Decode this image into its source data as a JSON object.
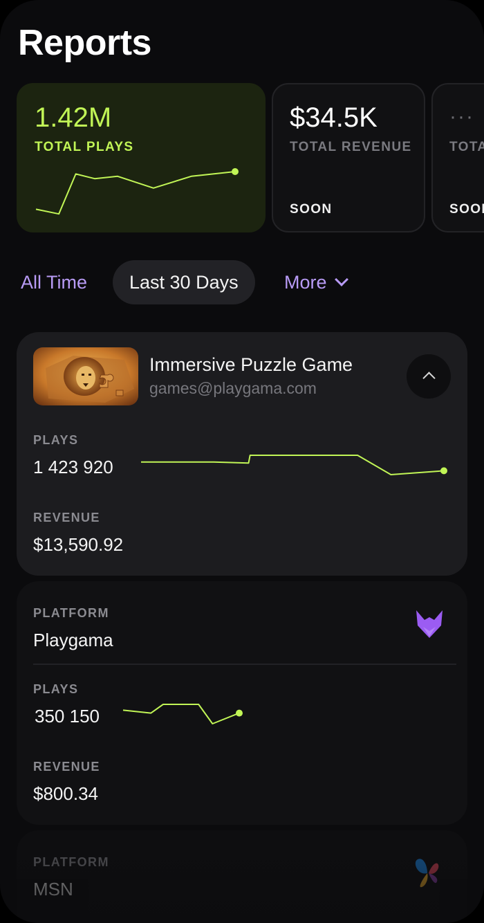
{
  "page": {
    "title": "Reports"
  },
  "stats": [
    {
      "value": "1.42M",
      "label": "TOTAL PLAYS",
      "trend": [
        0.2,
        0.1,
        0.95,
        0.85,
        0.9,
        0.65,
        0.9,
        1.0
      ]
    },
    {
      "value": "$34.5K",
      "label": "TOTAL REVENUE",
      "soon": "SOON"
    },
    {
      "value": "···",
      "label": "TOTA",
      "soon": "SOON"
    }
  ],
  "filters": {
    "all_time": "All Time",
    "last_30": "Last 30 Days",
    "more": "More"
  },
  "game": {
    "name": "Immersive Puzzle Game",
    "email": "games@playgama.com",
    "plays_label": "PLAYS",
    "plays_value": "1 423 920",
    "plays_trend": [
      0.65,
      0.65,
      0.6,
      1.0,
      1.0,
      1.0,
      0.0,
      0.2
    ],
    "revenue_label": "REVENUE",
    "revenue_value": "$13,590.92"
  },
  "platforms": [
    {
      "platform_label": "PLATFORM",
      "name": "Playgama",
      "plays_label": "PLAYS",
      "plays_value": "350 150",
      "plays_trend": [
        0.7,
        0.55,
        1.0,
        1.0,
        0.0,
        0.55
      ],
      "revenue_label": "REVENUE",
      "revenue_value": "$800.34",
      "logo": "playgama-fox-icon"
    },
    {
      "platform_label": "PLATFORM",
      "name": "MSN",
      "logo": "msn-butterfly-icon"
    }
  ],
  "colors": {
    "accent": "#c1f556",
    "purple": "#b89bf5",
    "card": "#1c1c1f"
  }
}
